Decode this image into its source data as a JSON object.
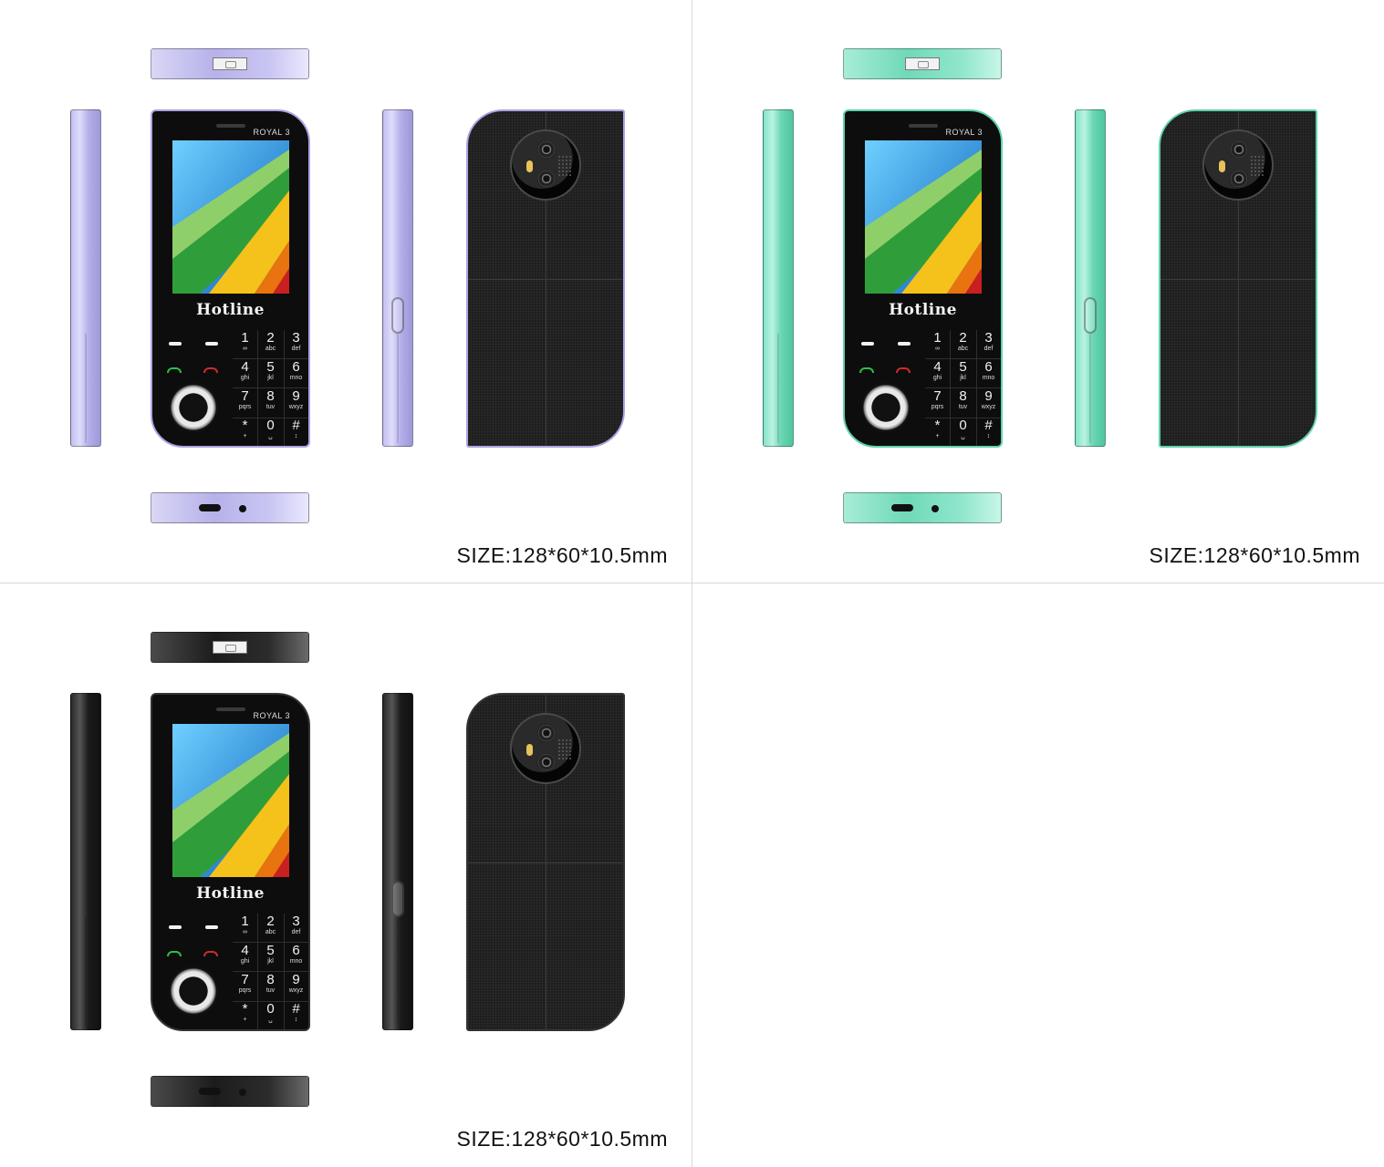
{
  "size_label": "SIZE:128*60*10.5mm",
  "model": "ROYAL 3",
  "brand": "Hotline",
  "variants": [
    {
      "color_name": "lavender",
      "accent": "#b6b2ea"
    },
    {
      "color_name": "mint",
      "accent": "#6fd9b8"
    },
    {
      "color_name": "black",
      "accent": "#1c1c1c"
    }
  ],
  "keys": [
    {
      "num": "1",
      "letters": "∞"
    },
    {
      "num": "2",
      "letters": "abc"
    },
    {
      "num": "3",
      "letters": "def"
    },
    {
      "num": "4",
      "letters": "ghi"
    },
    {
      "num": "5",
      "letters": "jkl"
    },
    {
      "num": "6",
      "letters": "mno"
    },
    {
      "num": "7",
      "letters": "pqrs"
    },
    {
      "num": "8",
      "letters": "tuv"
    },
    {
      "num": "9",
      "letters": "wxyz"
    },
    {
      "num": "*",
      "letters": "+"
    },
    {
      "num": "0",
      "letters": "␣"
    },
    {
      "num": "#",
      "letters": "↕"
    }
  ]
}
